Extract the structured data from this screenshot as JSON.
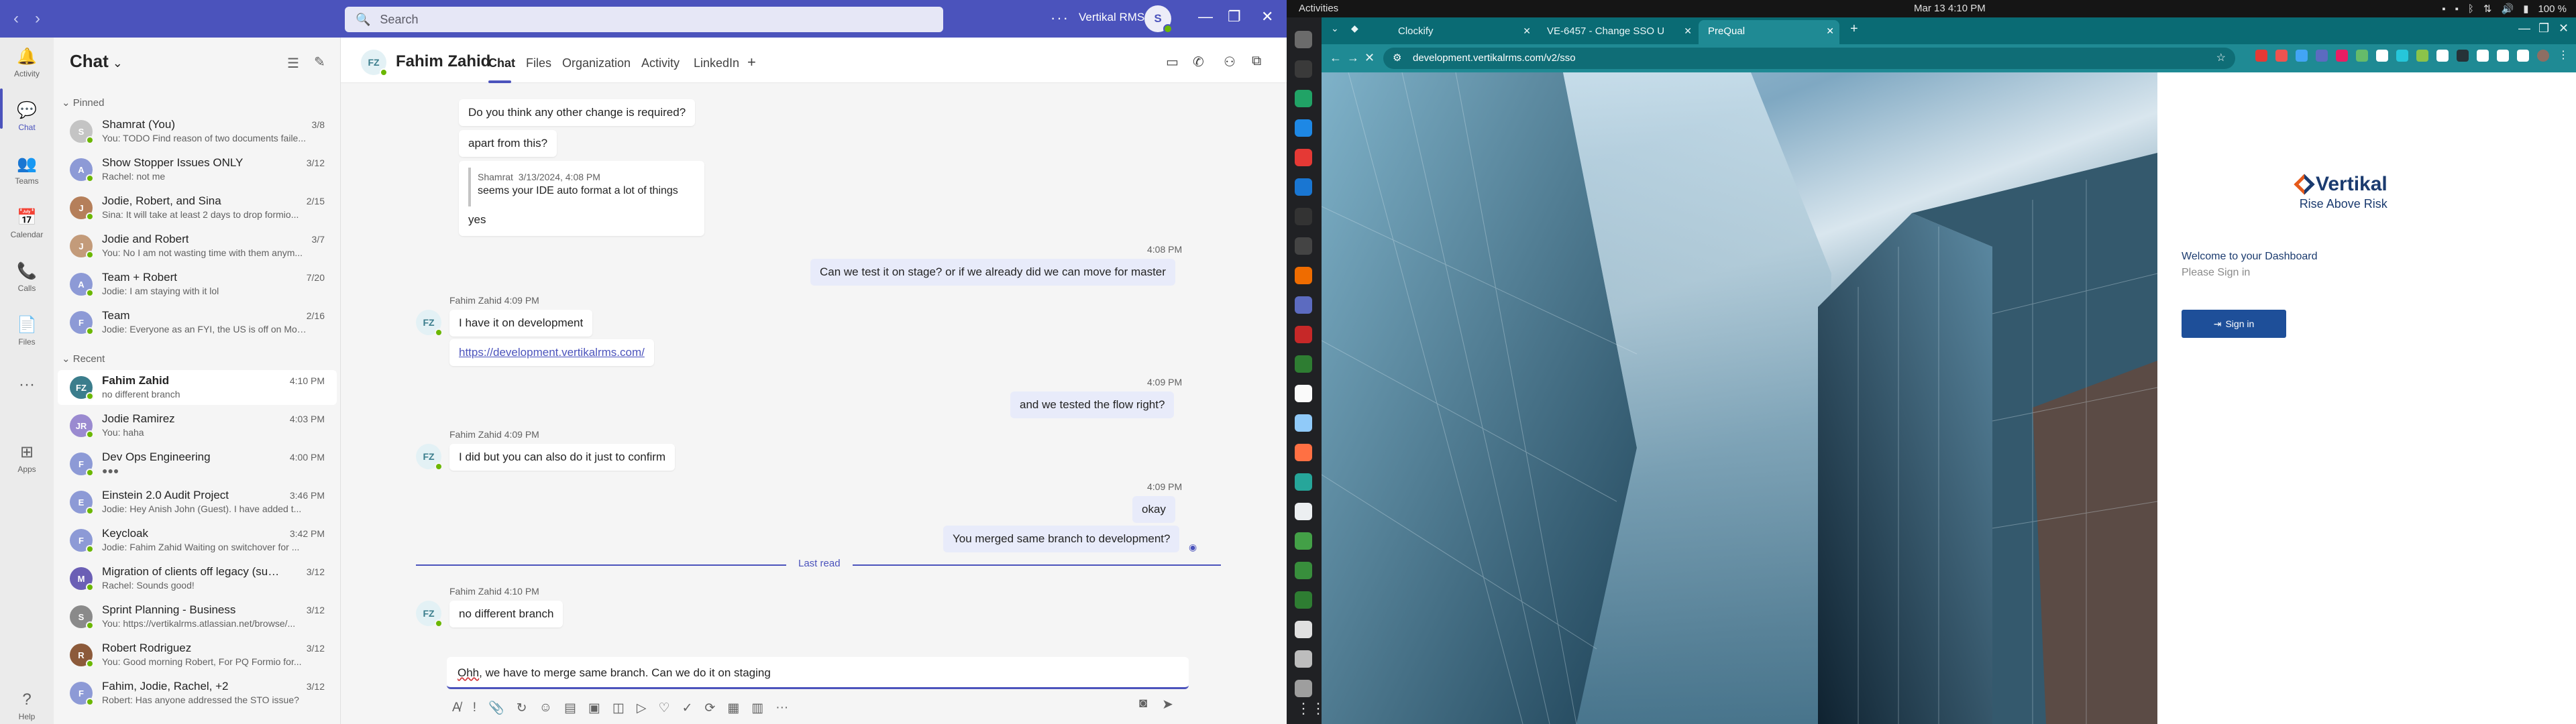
{
  "teams": {
    "search_placeholder": "Search",
    "org_name": "Vertikal RMS",
    "avatar_initial": "S",
    "rail": [
      {
        "label": "Activity",
        "icon": "bell-icon",
        "glyph": "🔔"
      },
      {
        "label": "Chat",
        "icon": "chat-icon",
        "glyph": "💬"
      },
      {
        "label": "Teams",
        "icon": "teams-icon",
        "glyph": "👥"
      },
      {
        "label": "Calendar",
        "icon": "calendar-icon",
        "glyph": "📅"
      },
      {
        "label": "Calls",
        "icon": "phone-icon",
        "glyph": "📞"
      },
      {
        "label": "Files",
        "icon": "file-icon",
        "glyph": "📄"
      },
      {
        "label": "",
        "icon": "more-icon",
        "glyph": "···"
      },
      {
        "label": "Apps",
        "icon": "apps-icon",
        "glyph": "⊞"
      },
      {
        "label": "Help",
        "icon": "help-icon",
        "glyph": "?"
      }
    ],
    "chatlist": {
      "title": "Chat",
      "pinned_label": "Pinned",
      "recent_label": "Recent",
      "pinned": [
        {
          "initials": "S",
          "color": "#c4c4c4",
          "name": "Shamrat (You)",
          "preview": "You: TODO Find reason of two documents faile...",
          "date": "3/8"
        },
        {
          "initials": "A",
          "color": "#8d9ad6",
          "name": "Show Stopper Issues ONLY",
          "preview": "Rachel: not me",
          "date": "3/12"
        },
        {
          "initials": "J",
          "color": "#b57f5a",
          "name": "Jodie, Robert, and Sina",
          "preview": "Sina: It will take at least 2 days to drop formio...",
          "date": "2/15"
        },
        {
          "initials": "J",
          "color": "#c39b7a",
          "name": "Jodie and Robert",
          "preview": "You: No I am not wasting time with them anym...",
          "date": "3/7"
        },
        {
          "initials": "A",
          "color": "#8d9ad6",
          "name": "Team + Robert",
          "preview": "Jodie: I am staying with it lol",
          "date": "7/20"
        },
        {
          "initials": "F",
          "color": "#8d9ad6",
          "name": "Team",
          "preview": "Jodie: Everyone as an FYI, the US is off on Mon...",
          "date": "2/16"
        }
      ],
      "recent": [
        {
          "initials": "FZ",
          "color": "#3b7d8c",
          "name": "Fahim Zahid",
          "preview": "no different branch",
          "date": "4:10 PM"
        },
        {
          "initials": "JR",
          "color": "#9a8ad0",
          "name": "Jodie Ramirez",
          "preview": "You: haha",
          "date": "4:03 PM"
        },
        {
          "initials": "F",
          "color": "#8d9ad6",
          "name": "Dev Ops Engineering",
          "preview": "●●●",
          "date": "4:00 PM"
        },
        {
          "initials": "E",
          "color": "#8d9ad6",
          "name": "Einstein 2.0 Audit Project",
          "preview": "Jodie: Hey Anish John (Guest). I have added t...",
          "date": "3:46 PM"
        },
        {
          "initials": "F",
          "color": "#8d9ad6",
          "name": "Keycloak",
          "preview": "Jodie: Fahim Zahid Waiting on switchover for ...",
          "date": "3:42 PM"
        },
        {
          "initials": "M",
          "color": "#6b5fb5",
          "name": "Migration of clients off legacy (sunse...",
          "preview": "Rachel: Sounds good!",
          "date": "3/12"
        },
        {
          "initials": "S",
          "color": "#8a8a8a",
          "name": "Sprint Planning - Business",
          "preview": "You: https://vertikalrms.atlassian.net/browse/...",
          "date": "3/12"
        },
        {
          "initials": "R",
          "color": "#8c5a3a",
          "name": "Robert Rodriguez",
          "preview": "You: Good morning Robert, For PQ Formio for...",
          "date": "3/12"
        },
        {
          "initials": "F",
          "color": "#8d9ad6",
          "name": "Fahim, Jodie, Rachel, +2",
          "preview": "Robert: Has anyone addressed the STO issue?",
          "date": "3/12"
        }
      ]
    },
    "conversation": {
      "contact_name": "Fahim Zahid",
      "contact_initials": "FZ",
      "tabs": [
        "Chat",
        "Files",
        "Organization",
        "Activity",
        "LinkedIn"
      ],
      "messages": {
        "m1": "Do you think any other change is required?",
        "m2": "apart from this?",
        "quote_author": "Shamrat",
        "quote_time": "3/13/2024, 4:08 PM",
        "quote_text": "seems your IDE auto format a lot of things",
        "m3": "yes",
        "t4": "4:08 PM",
        "m4": "Can we test it on stage? or if we already did we can move for master",
        "meta5": "Fahim Zahid  4:09 PM",
        "m5": "I have it on development",
        "m5_link": "https://development.vertikalrms.com/",
        "t6": "4:09 PM",
        "m6": "and we tested the flow right?",
        "meta7": "Fahim Zahid  4:09 PM",
        "m7": "I did but you can also do it just to confirm",
        "t8": "4:09 PM",
        "m8": "okay",
        "m9": "You merged same branch to development?",
        "last_read": "Last read",
        "meta10": "Fahim Zahid  4:10 PM",
        "m10": "no different branch"
      },
      "composer_misspelled": "Ohh",
      "composer_rest": ", we have to merge same branch. Can we do it on staging"
    }
  },
  "desktop": {
    "activities": "Activities",
    "clock": "Mar 13  4:10 PM",
    "battery": "100 %",
    "browser": {
      "tabs": [
        "Clockify",
        "VE-6457 - Change SSO U",
        "PreQual"
      ],
      "url": "development.vertikalrms.com/v2/sso"
    },
    "login": {
      "brand": "Vertikal",
      "tagline": "Rise Above Risk",
      "welcome": "Welcome to your Dashboard",
      "please": "Please Sign in",
      "signin": "Sign in"
    }
  }
}
